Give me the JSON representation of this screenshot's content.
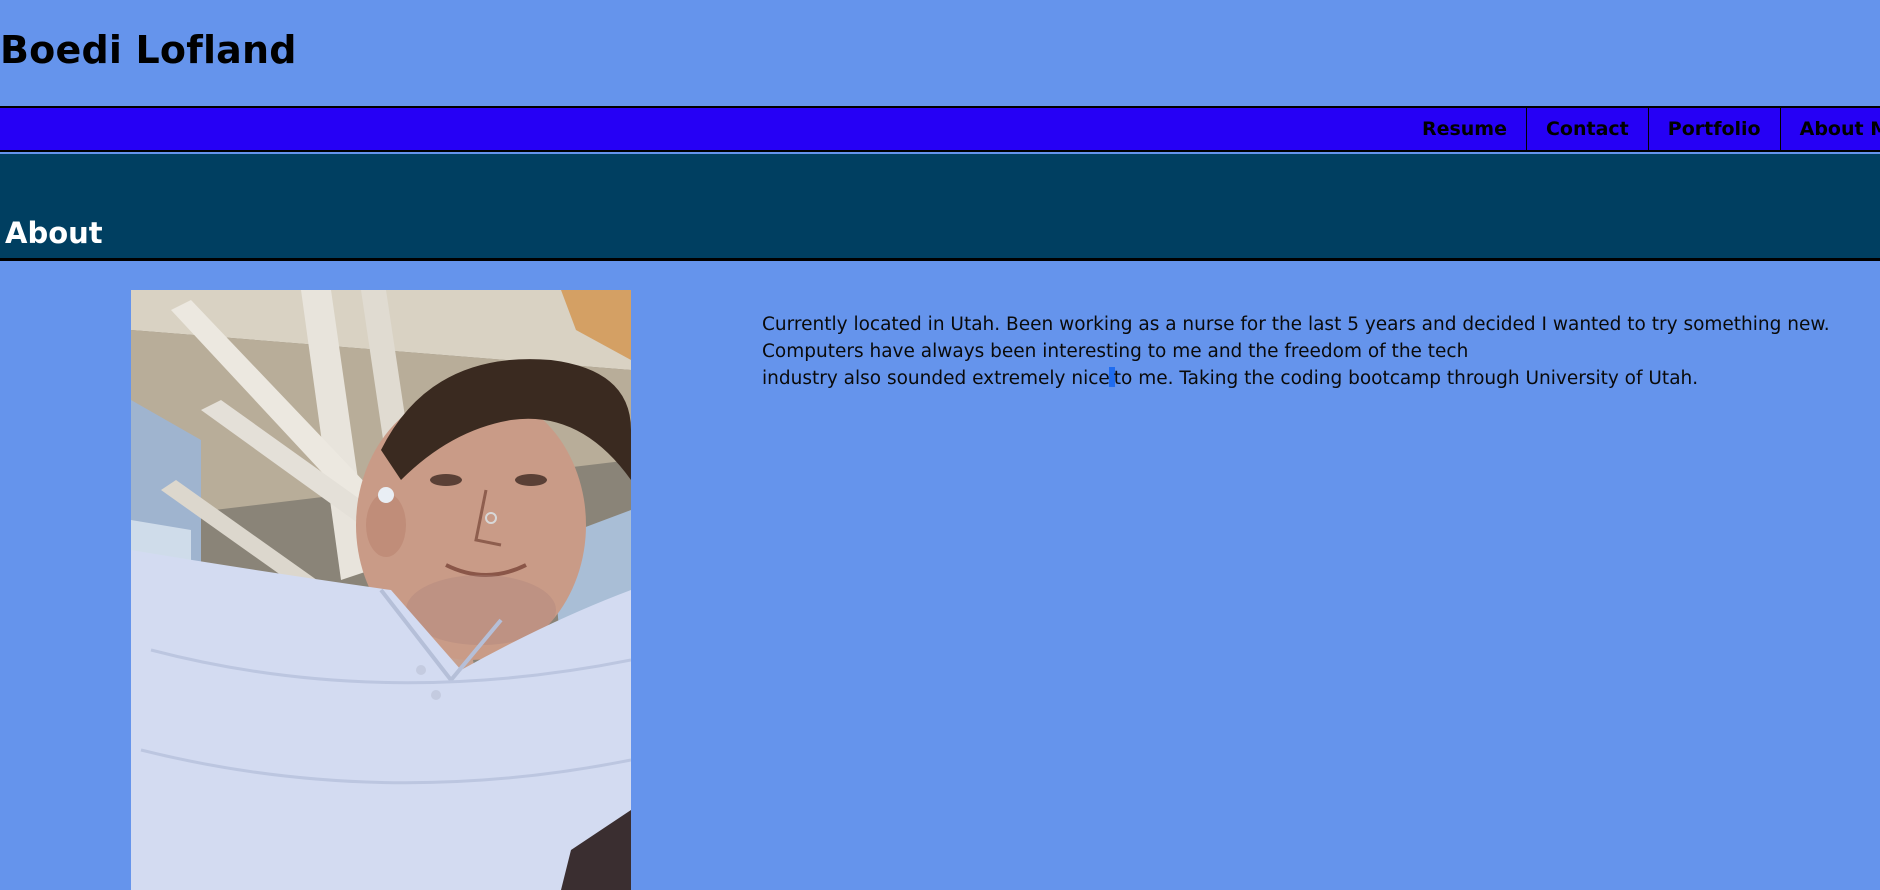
{
  "header": {
    "title": "Boedi Lofland"
  },
  "nav": {
    "items": [
      {
        "label": "Resume"
      },
      {
        "label": "Contact"
      },
      {
        "label": "Portfolio"
      },
      {
        "label": "About Me"
      }
    ]
  },
  "about": {
    "heading": "About",
    "line1": "Currently located in Utah. Been working as a nurse for the last 5 years and decided I wanted to try something new.",
    "line2": "Computers have always been interesting to me and the freedom of the tech",
    "line3_before": "industry also sounded extremely nice",
    "line3_after": "to me. Taking the coding bootcamp through University of Utah.",
    "photo_alt": "Profile photo"
  },
  "colors": {
    "page_background": "#6594ec",
    "nav_background": "#2600f5",
    "section_band": "#003f61",
    "text_cursor": "#1f6cf0"
  }
}
